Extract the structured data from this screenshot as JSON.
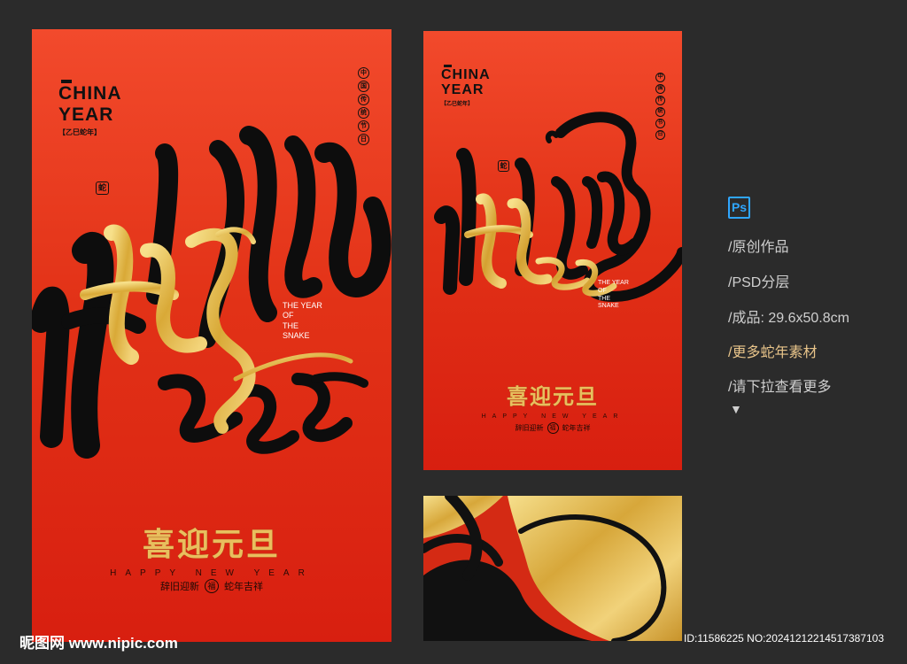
{
  "poster_main": {
    "brand_line1": "CHINA",
    "brand_line2": "YEAR",
    "brand_tag": "【乙巳蛇年】",
    "vertical_chars": [
      "中",
      "国",
      "传",
      "统",
      "节",
      "日"
    ],
    "seal": "蛇",
    "year_en": [
      "THE YEAR",
      "OF",
      "THE",
      "SNAKE"
    ],
    "greeting": "喜迎元旦",
    "happy_new_year": "HAPPY NEW YEAR",
    "blessing_left": "辞旧迎新",
    "fu": "福",
    "blessing_right": "蛇年吉祥"
  },
  "poster_alt": {
    "brand_line1": "CHINA",
    "brand_line2": "YEAR",
    "brand_tag": "【乙巳蛇年】",
    "vertical_chars": [
      "中",
      "国",
      "传",
      "统",
      "节",
      "日"
    ],
    "seal": "蛇",
    "year_en": [
      "THE YEAR",
      "OF",
      "THE",
      "SNAKE"
    ],
    "greeting": "喜迎元旦",
    "happy_new_year": "HAPPY NEW YEAR",
    "blessing_left": "辞旧迎新",
    "fu": "福",
    "blessing_right": "蛇年吉祥"
  },
  "sidebar": {
    "icon": "Ps",
    "items": [
      "/原创作品",
      "/PSD分层",
      "/成品: 29.6x50.8cm",
      "/更多蛇年素材",
      "/请下拉查看更多"
    ],
    "more_arrow": "▼"
  },
  "footer": {
    "watermark": "昵图网 www.nipic.com",
    "image_id": "ID:11586225 NO:20241212214517387103"
  },
  "colors": {
    "background": "#2b2b2b",
    "poster_red": "#e23217",
    "gold": "#e8bf5e",
    "ink": "#111111",
    "ps_blue": "#2fa6ff",
    "highlight": "#e8c48a"
  }
}
